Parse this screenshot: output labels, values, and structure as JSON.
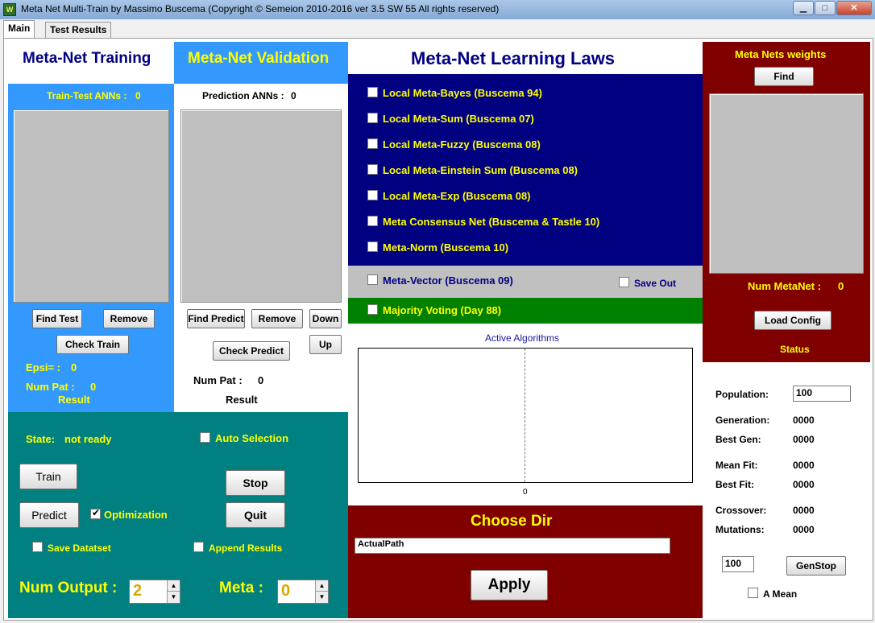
{
  "window": {
    "title": "Meta Net Multi-Train  by Massimo Buscema (Copyright © Semeion 2010-2016 ver 3.5  SW 55  All rights reserved)",
    "icon_text": "W",
    "minimize": "▁",
    "maximize": "□",
    "close": "✕"
  },
  "tabs": [
    {
      "label": "Main",
      "active": true
    },
    {
      "label": "Test Results",
      "active": false
    }
  ],
  "training": {
    "heading": "Meta-Net Training",
    "count_label": "Train-Test ANNs :",
    "count_value": "0",
    "find_test": "Find Test",
    "remove": "Remove",
    "check_train": "Check Train",
    "epsi_label": "Epsi= :",
    "epsi_value": "0",
    "numpat_label": "Num Pat :",
    "numpat_value": "0",
    "result_label": "Result"
  },
  "validation": {
    "heading": "Meta-Net Validation",
    "count_label": "Prediction ANNs :",
    "count_value": "0",
    "find_predict": "Find Predict",
    "remove": "Remove",
    "down": "Down",
    "check_predict": "Check Predict",
    "up": "Up",
    "numpat_label": "Num Pat :",
    "numpat_value": "0",
    "result_label": "Result"
  },
  "controls": {
    "state_label": "State:",
    "state_value": "not ready",
    "auto_selection": "Auto Selection",
    "train": "Train",
    "stop": "Stop",
    "predict": "Predict",
    "optimization": "Optimization",
    "quit": "Quit",
    "save_dataset": "Save Datatset",
    "append_results": "Append Results",
    "num_output_label": "Num Output :",
    "num_output_value": "2",
    "meta_label": "Meta :",
    "meta_value": "0"
  },
  "laws": {
    "heading": "Meta-Net Learning Laws",
    "items": [
      {
        "label": "Local Meta-Bayes (Buscema 94)"
      },
      {
        "label": "Local Meta-Sum (Buscema 07)"
      },
      {
        "label": "Local Meta-Fuzzy (Buscema 08)"
      },
      {
        "label": "Local Meta-Einstein Sum (Buscema 08)"
      },
      {
        "label": "Local Meta-Exp (Buscema 08)"
      },
      {
        "label": "Meta Consensus Net  (Buscema & Tastle 10)"
      },
      {
        "label": "Meta-Norm  (Buscema 10)"
      }
    ],
    "meta_vector": "Meta-Vector (Buscema 09)",
    "save_out": "Save Out",
    "majority_voting": "Majority Voting (Day 88)"
  },
  "chart": {
    "title": "Active Algorithms",
    "x_tick": "0"
  },
  "chart_data": {
    "type": "bar",
    "title": "Active Algorithms",
    "categories": [],
    "values": [],
    "xticks": [
      "0"
    ],
    "grid": false
  },
  "directory": {
    "heading": "Choose Dir",
    "path": "ActualPath",
    "apply": "Apply"
  },
  "weights": {
    "heading": "Meta Nets weights",
    "find": "Find",
    "num_metanet_label": "Num MetaNet :",
    "num_metanet_value": "0",
    "load_config": "Load Config",
    "status_label": "Status"
  },
  "genetic": {
    "population_label": "Population:",
    "population_value": "100",
    "generation_label": "Generation:",
    "generation_value": "0000",
    "best_gen_label": "Best Gen:",
    "best_gen_value": "0000",
    "mean_fit_label": "Mean Fit:",
    "mean_fit_value": "0000",
    "best_fit_label": "Best Fit:",
    "best_fit_value": "0000",
    "crossover_label": "Crossover:",
    "crossover_value": "0000",
    "mutations_label": "Mutations:",
    "mutations_value": "0000",
    "gen_input_value": "100",
    "genstop": "GenStop",
    "a_mean": "A Mean"
  },
  "colors": {
    "navy": "#000080",
    "blue_panel": "#3399ff",
    "teal": "#008080",
    "dark_red": "#800000",
    "green": "#008000",
    "yellow_text": "#ffff00"
  }
}
